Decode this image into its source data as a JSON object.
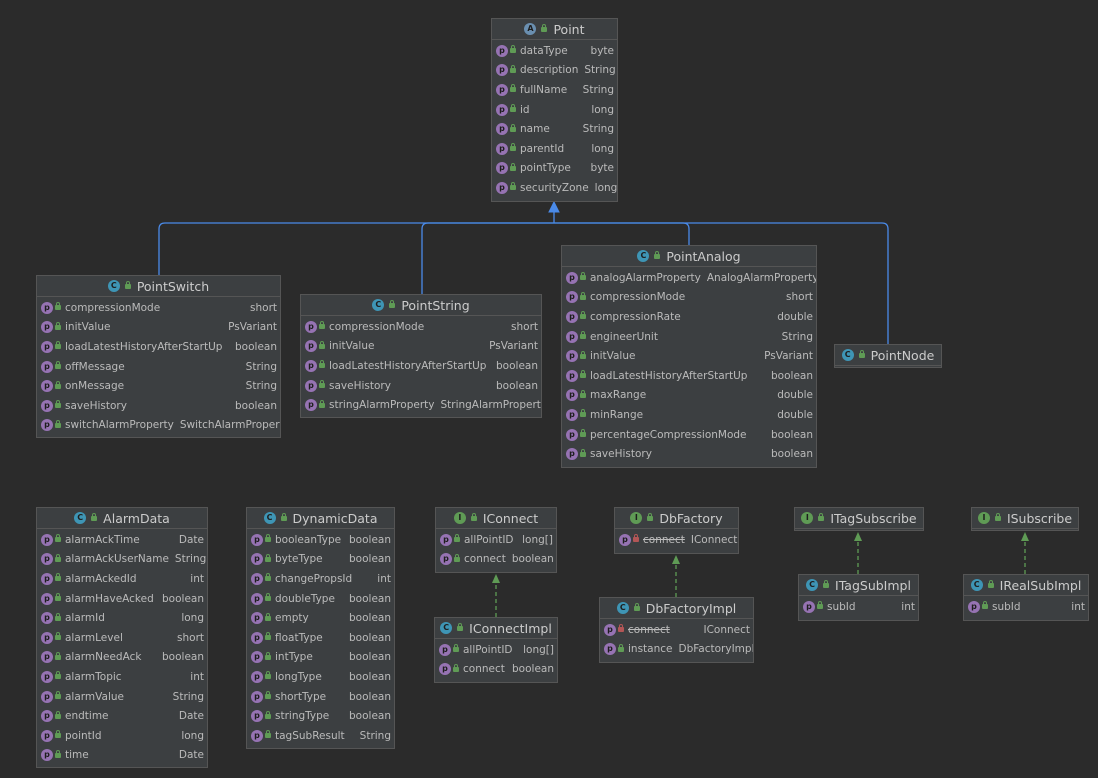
{
  "colors": {
    "background": "#2b2b2b",
    "box": "#3c3f41",
    "border": "#555555",
    "inheritance_edge": "#4a8ae8",
    "implements_edge": "#5f9b55",
    "class_icon": "#3e95b5",
    "interface_icon": "#5f9b55",
    "property_icon": "#9673b3"
  },
  "classes": {
    "point": {
      "name": "Point",
      "kind": "abstract",
      "fields": [
        {
          "name": "dataType",
          "type": "byte"
        },
        {
          "name": "description",
          "type": "String"
        },
        {
          "name": "fullName",
          "type": "String"
        },
        {
          "name": "id",
          "type": "long"
        },
        {
          "name": "name",
          "type": "String"
        },
        {
          "name": "parentId",
          "type": "long"
        },
        {
          "name": "pointType",
          "type": "byte"
        },
        {
          "name": "securityZone",
          "type": "long"
        }
      ]
    },
    "point_switch": {
      "name": "PointSwitch",
      "kind": "class",
      "fields": [
        {
          "name": "compressionMode",
          "type": "short"
        },
        {
          "name": "initValue",
          "type": "PsVariant"
        },
        {
          "name": "loadLatestHistoryAfterStartUp",
          "type": "boolean"
        },
        {
          "name": "offMessage",
          "type": "String"
        },
        {
          "name": "onMessage",
          "type": "String"
        },
        {
          "name": "saveHistory",
          "type": "boolean"
        },
        {
          "name": "switchAlarmProperty",
          "type": "SwitchAlarmProperty"
        }
      ]
    },
    "point_string": {
      "name": "PointString",
      "kind": "class",
      "fields": [
        {
          "name": "compressionMode",
          "type": "short"
        },
        {
          "name": "initValue",
          "type": "PsVariant"
        },
        {
          "name": "loadLatestHistoryAfterStartUp",
          "type": "boolean"
        },
        {
          "name": "saveHistory",
          "type": "boolean"
        },
        {
          "name": "stringAlarmProperty",
          "type": "StringAlarmProperty"
        }
      ]
    },
    "point_analog": {
      "name": "PointAnalog",
      "kind": "class",
      "fields": [
        {
          "name": "analogAlarmProperty",
          "type": "AnalogAlarmProperty"
        },
        {
          "name": "compressionMode",
          "type": "short"
        },
        {
          "name": "compressionRate",
          "type": "double"
        },
        {
          "name": "engineerUnit",
          "type": "String"
        },
        {
          "name": "initValue",
          "type": "PsVariant"
        },
        {
          "name": "loadLatestHistoryAfterStartUp",
          "type": "boolean"
        },
        {
          "name": "maxRange",
          "type": "double"
        },
        {
          "name": "minRange",
          "type": "double"
        },
        {
          "name": "percentageCompressionMode",
          "type": "boolean"
        },
        {
          "name": "saveHistory",
          "type": "boolean"
        }
      ]
    },
    "point_node": {
      "name": "PointNode",
      "kind": "class",
      "fields": []
    },
    "alarm_data": {
      "name": "AlarmData",
      "kind": "class",
      "fields": [
        {
          "name": "alarmAckTime",
          "type": "Date"
        },
        {
          "name": "alarmAckUserName",
          "type": "String"
        },
        {
          "name": "alarmAckedId",
          "type": "int"
        },
        {
          "name": "alarmHaveAcked",
          "type": "boolean"
        },
        {
          "name": "alarmId",
          "type": "long"
        },
        {
          "name": "alarmLevel",
          "type": "short"
        },
        {
          "name": "alarmNeedAck",
          "type": "boolean"
        },
        {
          "name": "alarmTopic",
          "type": "int"
        },
        {
          "name": "alarmValue",
          "type": "String"
        },
        {
          "name": "endtime",
          "type": "Date"
        },
        {
          "name": "pointId",
          "type": "long"
        },
        {
          "name": "time",
          "type": "Date"
        }
      ]
    },
    "dynamic_data": {
      "name": "DynamicData",
      "kind": "class",
      "fields": [
        {
          "name": "booleanType",
          "type": "boolean"
        },
        {
          "name": "byteType",
          "type": "boolean"
        },
        {
          "name": "changePropsId",
          "type": "int"
        },
        {
          "name": "doubleType",
          "type": "boolean"
        },
        {
          "name": "empty",
          "type": "boolean"
        },
        {
          "name": "floatType",
          "type": "boolean"
        },
        {
          "name": "intType",
          "type": "boolean"
        },
        {
          "name": "longType",
          "type": "boolean"
        },
        {
          "name": "shortType",
          "type": "boolean"
        },
        {
          "name": "stringType",
          "type": "boolean"
        },
        {
          "name": "tagSubResult",
          "type": "String"
        }
      ]
    },
    "iconnect": {
      "name": "IConnect",
      "kind": "interface",
      "fields": [
        {
          "name": "allPointID",
          "type": "long[]"
        },
        {
          "name": "connect",
          "type": "boolean"
        }
      ]
    },
    "iconnect_impl": {
      "name": "IConnectImpl",
      "kind": "class",
      "fields": [
        {
          "name": "allPointID",
          "type": "long[]"
        },
        {
          "name": "connect",
          "type": "boolean"
        }
      ]
    },
    "db_factory": {
      "name": "DbFactory",
      "kind": "interface",
      "fields": [
        {
          "name": "connect",
          "type": "IConnect",
          "deprecated": true
        }
      ]
    },
    "db_factory_impl": {
      "name": "DbFactoryImpl",
      "kind": "class",
      "fields": [
        {
          "name": "connect",
          "type": "IConnect",
          "deprecated": true
        },
        {
          "name": "instance",
          "type": "DbFactoryImpl"
        }
      ]
    },
    "itag_subscribe": {
      "name": "ITagSubscribe",
      "kind": "interface",
      "fields": []
    },
    "itag_sub_impl": {
      "name": "ITagSubImpl",
      "kind": "class",
      "fields": [
        {
          "name": "subId",
          "type": "int"
        }
      ]
    },
    "isubscribe": {
      "name": "ISubscribe",
      "kind": "interface",
      "fields": []
    },
    "ireal_sub_impl": {
      "name": "IRealSubImpl",
      "kind": "class",
      "fields": [
        {
          "name": "subId",
          "type": "int"
        }
      ]
    }
  },
  "relations": [
    {
      "from": "point_switch",
      "to": "point",
      "type": "extends"
    },
    {
      "from": "point_string",
      "to": "point",
      "type": "extends"
    },
    {
      "from": "point_analog",
      "to": "point",
      "type": "extends"
    },
    {
      "from": "point_node",
      "to": "point",
      "type": "extends"
    },
    {
      "from": "iconnect_impl",
      "to": "iconnect",
      "type": "implements"
    },
    {
      "from": "db_factory_impl",
      "to": "db_factory",
      "type": "implements"
    },
    {
      "from": "itag_sub_impl",
      "to": "itag_subscribe",
      "type": "implements"
    },
    {
      "from": "ireal_sub_impl",
      "to": "isubscribe",
      "type": "implements"
    }
  ]
}
